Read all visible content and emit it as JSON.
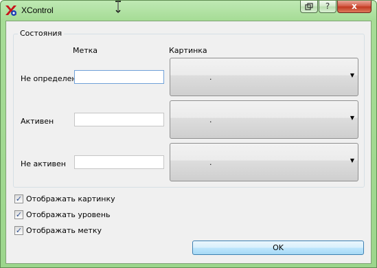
{
  "window": {
    "title": "XControl",
    "buttons": {
      "restore": "",
      "help": "?",
      "close": "x"
    }
  },
  "group": {
    "title": "Состояния",
    "col_label": "Метка",
    "col_picture": "Картинка",
    "rows": [
      {
        "label": "Не определен",
        "text_value": "",
        "picture_value": "."
      },
      {
        "label": "Активен",
        "text_value": "",
        "picture_value": "."
      },
      {
        "label": "Не активен",
        "text_value": "",
        "picture_value": "."
      }
    ]
  },
  "options": [
    {
      "label": "Отображать картинку",
      "checked": true
    },
    {
      "label": "Отображать уровень",
      "checked": true
    },
    {
      "label": "Отображать метку",
      "checked": true
    }
  ],
  "ok_label": "OK",
  "icons": {
    "app": "xcontrol-app-icon",
    "combo": "dropdown-arrow-icon",
    "check": "checkmark-icon"
  }
}
